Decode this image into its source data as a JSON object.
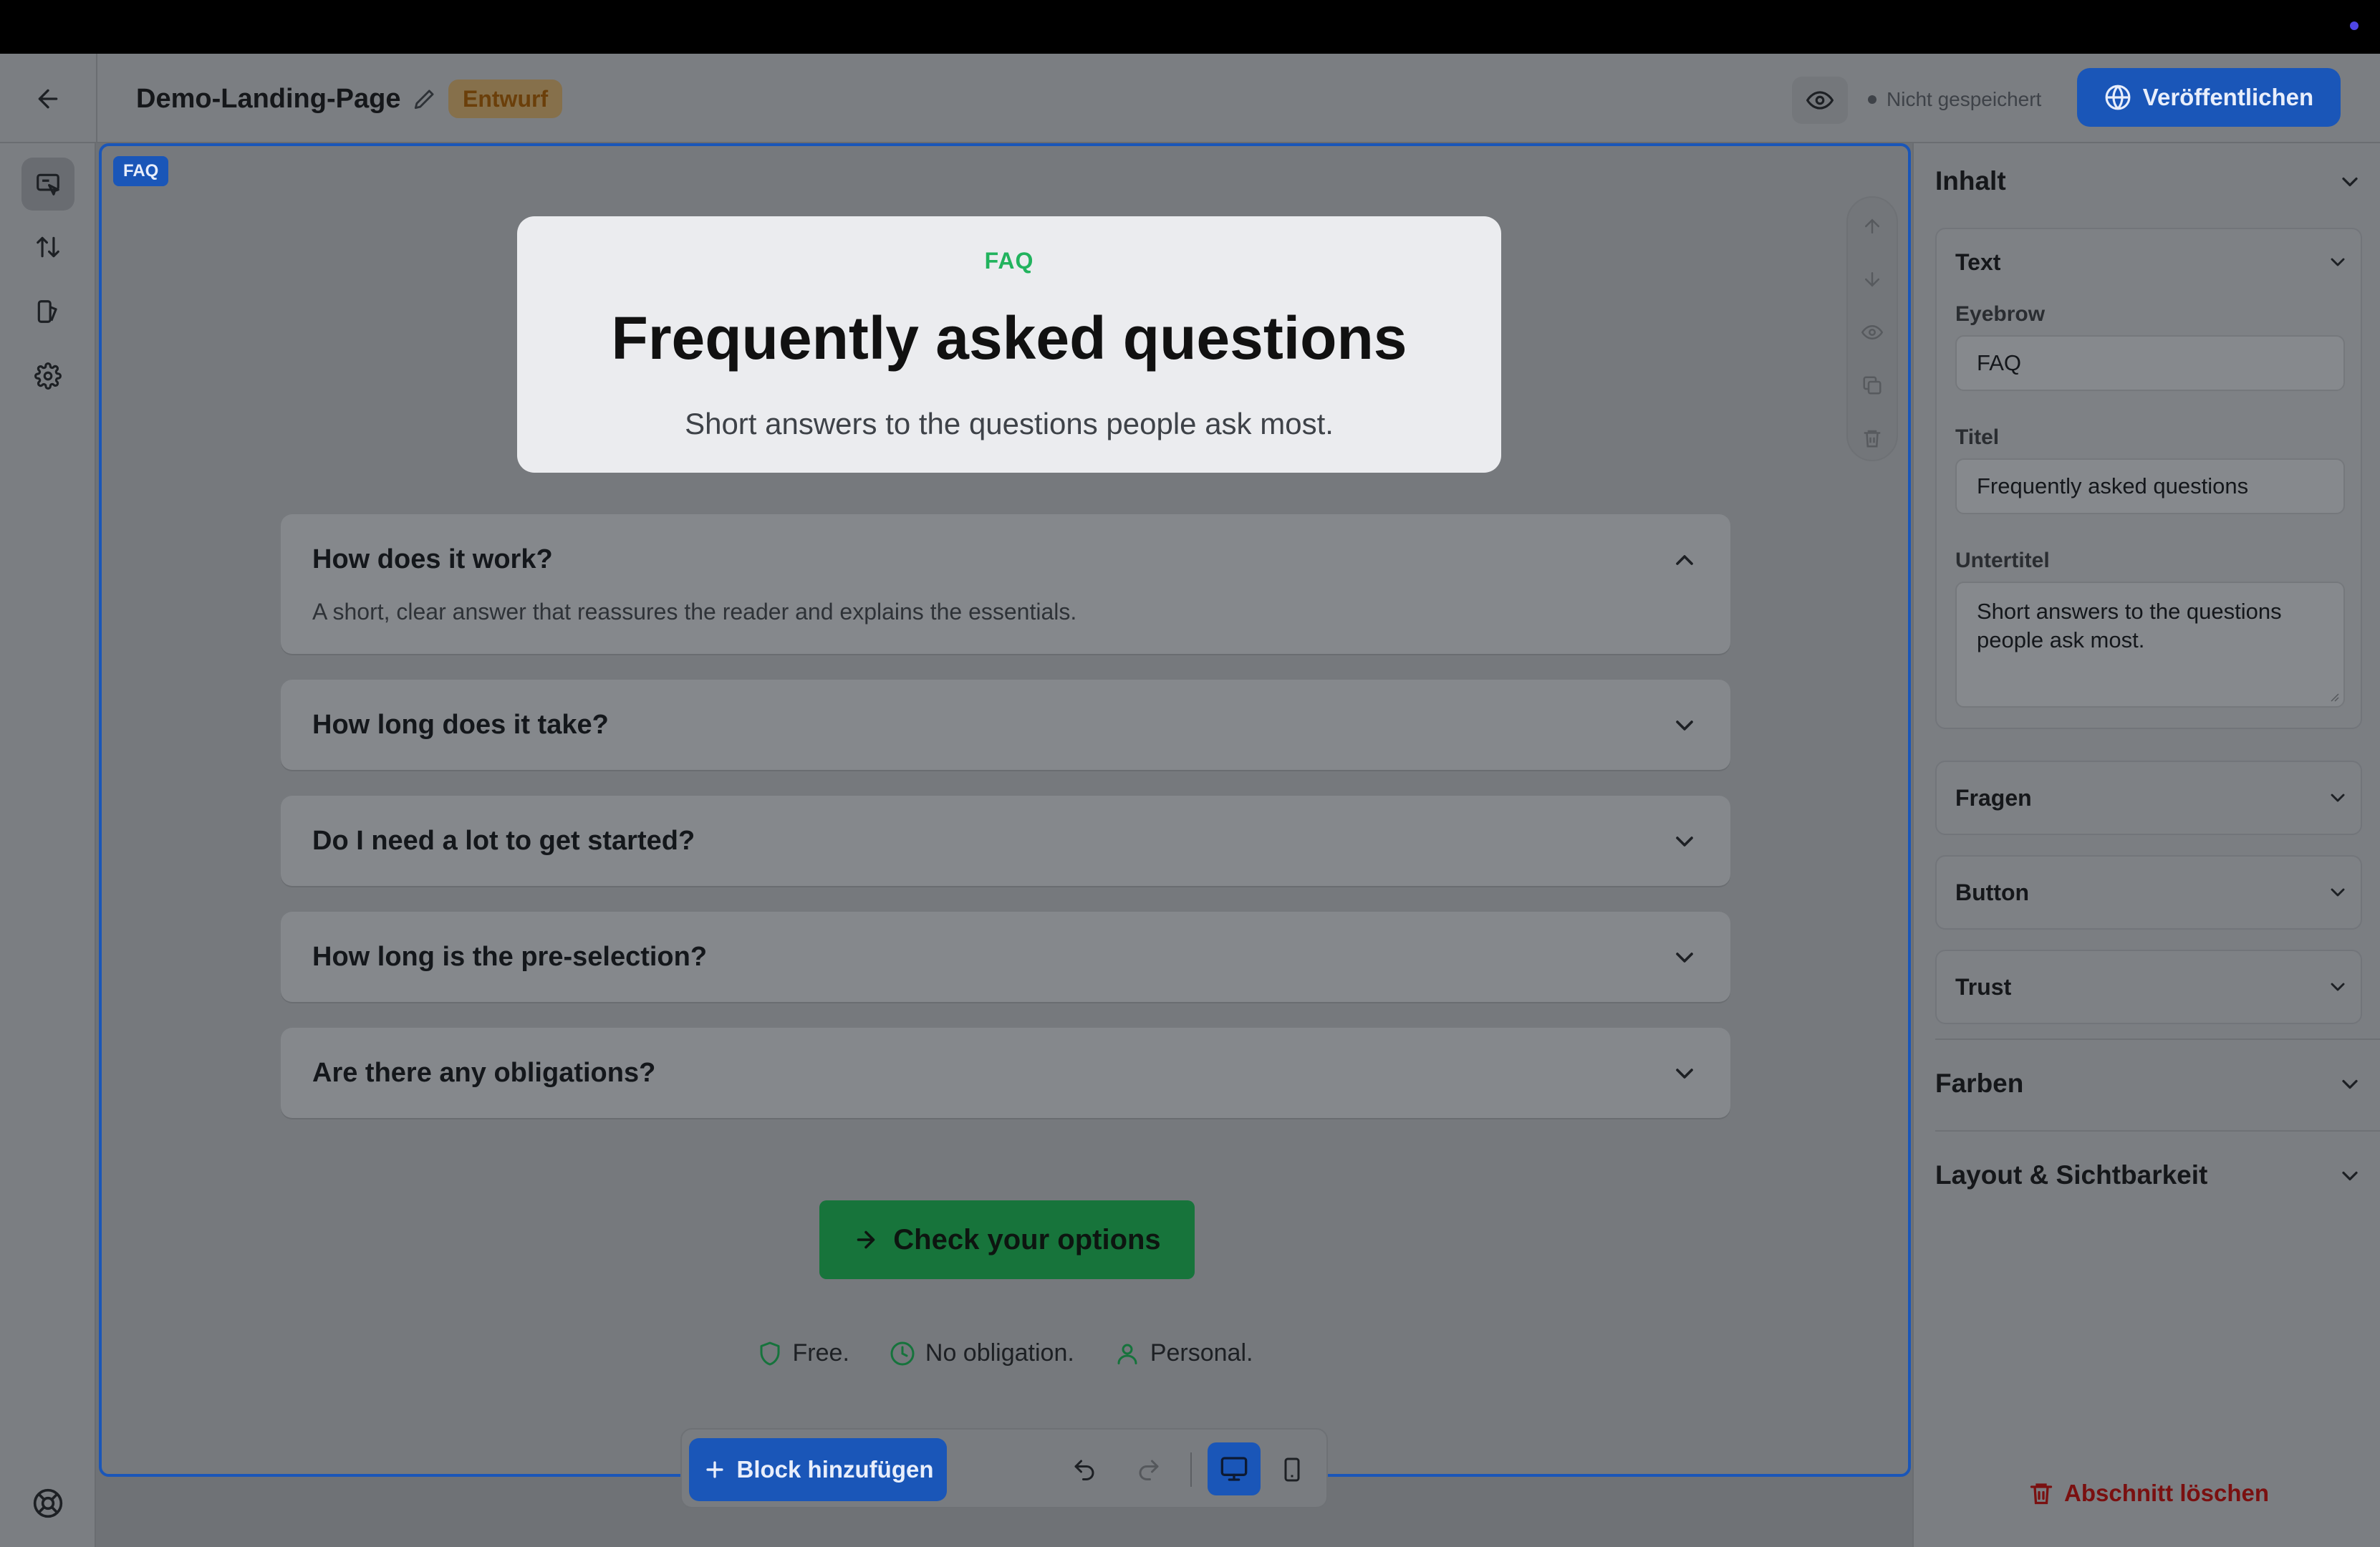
{
  "header": {
    "page_name": "Demo-Landing-Page",
    "status_badge": "Entwurf",
    "save_status": "Nicht gespeichert",
    "publish_label": "Veröffentlichen"
  },
  "canvas": {
    "section_tag": "FAQ",
    "hero": {
      "eyebrow": "FAQ",
      "title": "Frequently asked questions",
      "subtitle": "Short answers to the questions people ask most."
    },
    "faq": [
      {
        "question": "How does it work?",
        "answer": "A short, clear answer that reassures the reader and explains the essentials.",
        "open": true
      },
      {
        "question": "How long does it take?",
        "answer": "",
        "open": false
      },
      {
        "question": "Do I need a lot to get started?",
        "answer": "",
        "open": false
      },
      {
        "question": "How long is the pre-selection?",
        "answer": "",
        "open": false
      },
      {
        "question": "Are there any obligations?",
        "answer": "",
        "open": false
      }
    ],
    "cta_label": "Check your options",
    "trust": [
      {
        "icon": "shield-icon",
        "label": "Free."
      },
      {
        "icon": "clock-icon",
        "label": "No obligation."
      },
      {
        "icon": "person-icon",
        "label": "Personal."
      }
    ]
  },
  "bottom_bar": {
    "add_block_label": "Block hinzufügen"
  },
  "right_panel": {
    "content_heading": "Inhalt",
    "text_card": {
      "heading": "Text",
      "eyebrow_label": "Eyebrow",
      "eyebrow_value": "FAQ",
      "title_label": "Titel",
      "title_value": "Frequently asked questions",
      "subtitle_label": "Untertitel",
      "subtitle_value": "Short answers to the questions people ask most."
    },
    "cards": [
      "Fragen",
      "Button",
      "Trust"
    ],
    "colors_heading": "Farben",
    "layout_heading": "Layout & Sichtbarkeit",
    "delete_label": "Abschnitt löschen"
  },
  "colors": {
    "accent": "#1a56b8",
    "eyebrow": "#22b35e",
    "cta": "#17743b",
    "delete": "#7a1010"
  }
}
